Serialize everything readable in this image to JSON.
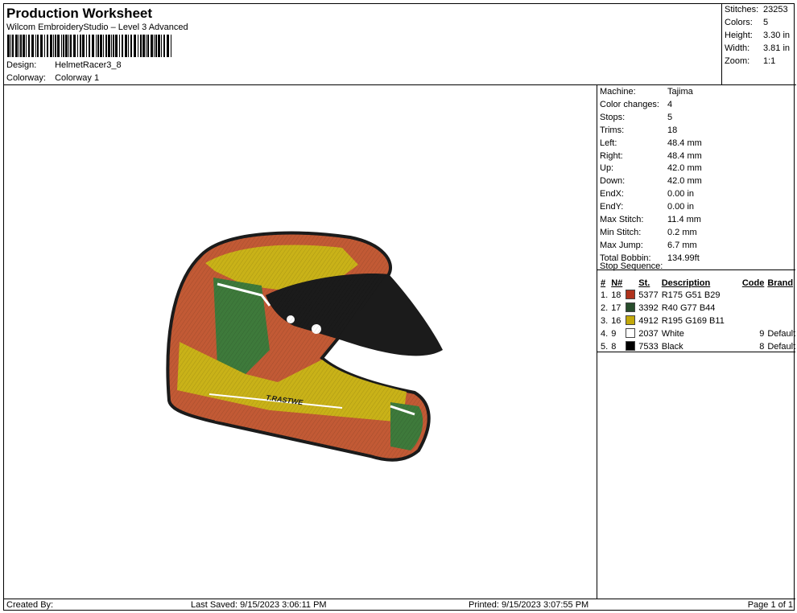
{
  "header": {
    "title": "Production Worksheet",
    "subtitle": "Wilcom EmbroideryStudio – Level 3 Advanced",
    "design_label": "Design:",
    "design_value": "HelmetRacer3_8",
    "colorway_label": "Colorway:",
    "colorway_value": "Colorway 1"
  },
  "summary": {
    "stitches_label": "Stitches:",
    "stitches_value": "23253",
    "colors_label": "Colors:",
    "colors_value": "5",
    "height_label": "Height:",
    "height_value": "3.30 in",
    "width_label": "Width:",
    "width_value": "3.81 in",
    "zoom_label": "Zoom:",
    "zoom_value": "1:1"
  },
  "machine_info": [
    {
      "label": "Machine:",
      "value": "Tajima"
    },
    {
      "label": "Color changes:",
      "value": "4"
    },
    {
      "label": "Stops:",
      "value": "5"
    },
    {
      "label": "Trims:",
      "value": "18"
    },
    {
      "label": "Left:",
      "value": "48.4 mm"
    },
    {
      "label": "Right:",
      "value": "48.4 mm"
    },
    {
      "label": "Up:",
      "value": "42.0 mm"
    },
    {
      "label": "Down:",
      "value": "42.0 mm"
    },
    {
      "label": "EndX:",
      "value": "0.00 in"
    },
    {
      "label": "EndY:",
      "value": "0.00 in"
    },
    {
      "label": "Max Stitch:",
      "value": "11.4 mm"
    },
    {
      "label": "Min Stitch:",
      "value": "0.2 mm"
    },
    {
      "label": "Max Jump:",
      "value": "6.7 mm"
    },
    {
      "label": "Total Bobbin:",
      "value": "134.99ft"
    }
  ],
  "stop_sequence": {
    "title": "Stop Sequence:",
    "columns": [
      "#",
      "N#",
      "St.",
      "Description",
      "Code",
      "Brand"
    ],
    "rows": [
      {
        "num": "1.",
        "n": "18",
        "color": "#AF331D",
        "st": "5377",
        "desc": "R175 G51 B29",
        "code": "",
        "brand": ""
      },
      {
        "num": "2.",
        "n": "17",
        "color": "#284D2C",
        "st": "3392",
        "desc": "R40 G77 B44",
        "code": "",
        "brand": ""
      },
      {
        "num": "3.",
        "n": "16",
        "color": "#C3A90B",
        "st": "4912",
        "desc": "R195 G169 B11",
        "code": "",
        "brand": ""
      },
      {
        "num": "4.",
        "n": "9",
        "color": "#FFFFFF",
        "st": "2037",
        "desc": "White",
        "code": "9",
        "brand": "Default"
      },
      {
        "num": "5.",
        "n": "8",
        "color": "#000000",
        "st": "7533",
        "desc": "Black",
        "code": "8",
        "brand": "Default"
      }
    ]
  },
  "design_preview": {
    "helmet_text": "T.RASTWE",
    "colors": {
      "red": "#C25A35",
      "green": "#3E7A3B",
      "yellow": "#C9B218",
      "white": "#FFFFFF",
      "black": "#1B1B1B"
    }
  },
  "footer": {
    "created": "Created By:",
    "saved": "Last Saved: 9/15/2023 3:06:11 PM",
    "printed": "Printed: 9/15/2023 3:07:55 PM",
    "page": "Page 1 of 1"
  }
}
